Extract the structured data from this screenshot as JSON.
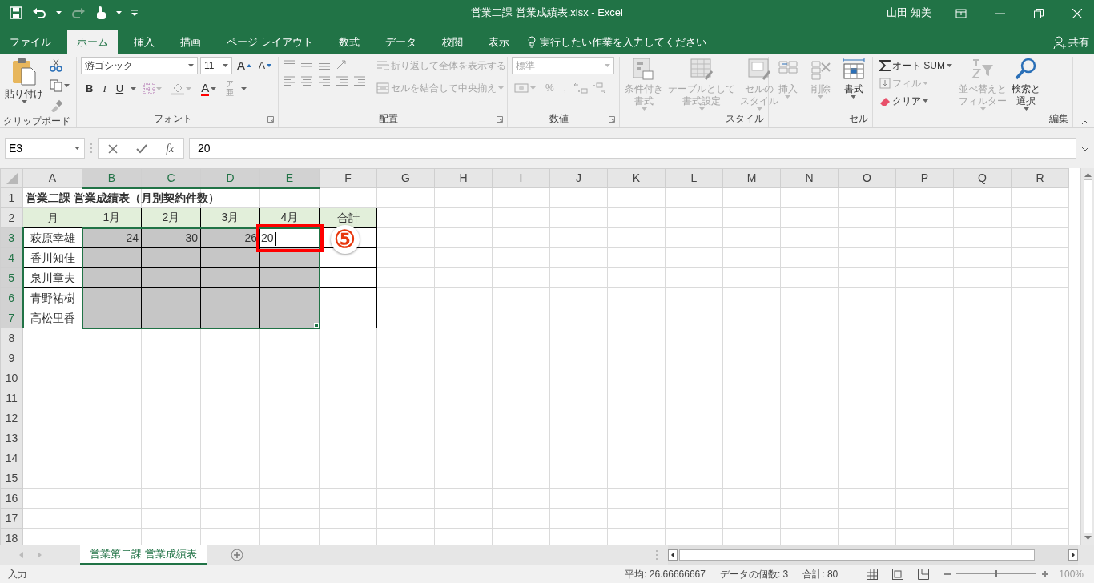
{
  "window": {
    "title": "営業二課 営業成績表.xlsx  -  Excel",
    "user": "山田 知美"
  },
  "ribbon_tabs": [
    {
      "label": "ファイル",
      "selected": false
    },
    {
      "label": "ホーム",
      "selected": true
    },
    {
      "label": "挿入",
      "selected": false
    },
    {
      "label": "描画",
      "selected": false
    },
    {
      "label": "ページ レイアウト",
      "selected": false
    },
    {
      "label": "数式",
      "selected": false
    },
    {
      "label": "データ",
      "selected": false
    },
    {
      "label": "校閲",
      "selected": false
    },
    {
      "label": "表示",
      "selected": false
    }
  ],
  "tell_me": {
    "placeholder": "実行したい作業を入力してください"
  },
  "share": "共有",
  "clipboard": {
    "paste": "貼り付け",
    "label": "クリップボード"
  },
  "font": {
    "name": "游ゴシック",
    "size": "11",
    "grow": "A",
    "shrink": "A",
    "styles": [
      "B",
      "I",
      "U"
    ],
    "color_button": "A",
    "phonetic": [
      "ア",
      "亜"
    ],
    "label": "フォント"
  },
  "alignment": {
    "wrap": "折り返して全体を表示する",
    "merge": "セルを結合して中央揃え",
    "label": "配置"
  },
  "number": {
    "format": "標準",
    "percent": "%",
    "comma": ",",
    "label": "数値"
  },
  "styles": {
    "buttons": [
      {
        "lines": [
          "条件付き",
          "書式"
        ],
        "disabled": true
      },
      {
        "lines": [
          "テーブルとして",
          "書式設定"
        ],
        "disabled": true
      },
      {
        "lines": [
          "セルの",
          "スタイル"
        ],
        "disabled": true
      }
    ],
    "label": "スタイル"
  },
  "cells": {
    "buttons": [
      {
        "lines": [
          "挿入"
        ],
        "disabled": true
      },
      {
        "lines": [
          "削除"
        ],
        "disabled": true
      },
      {
        "lines": [
          "書式"
        ],
        "disabled": false
      }
    ],
    "label": "セル"
  },
  "editing": {
    "autosum": "オート SUM",
    "fill": {
      "text": "フィル",
      "disabled": true
    },
    "clear": {
      "text": "クリア",
      "disabled": false
    },
    "sort": {
      "lines": [
        "並べ替えと",
        "フィルター"
      ],
      "disabled": true
    },
    "find": {
      "lines": [
        "検索と",
        "選択"
      ],
      "disabled": false
    },
    "label": "編集"
  },
  "formula_bar": {
    "name_box": "E3",
    "fx": "fx",
    "value": "20"
  },
  "columns": [
    {
      "label": "A",
      "selected": false
    },
    {
      "label": "B",
      "selected": true
    },
    {
      "label": "C",
      "selected": true
    },
    {
      "label": "D",
      "selected": true
    },
    {
      "label": "E",
      "selected": true
    },
    {
      "label": "F",
      "selected": false
    },
    {
      "label": "G",
      "selected": false
    },
    {
      "label": "H",
      "selected": false
    },
    {
      "label": "I",
      "selected": false
    },
    {
      "label": "J",
      "selected": false
    },
    {
      "label": "K",
      "selected": false
    },
    {
      "label": "L",
      "selected": false
    },
    {
      "label": "M",
      "selected": false
    },
    {
      "label": "N",
      "selected": false
    },
    {
      "label": "O",
      "selected": false
    },
    {
      "label": "P",
      "selected": false
    },
    {
      "label": "Q",
      "selected": false
    },
    {
      "label": "R",
      "selected": false
    }
  ],
  "rows": [
    {
      "label": "1",
      "selected": false,
      "cells": [
        {
          "kind": "title",
          "text": "営業二課 営業成績表（月別契約件数）",
          "selected": false
        }
      ]
    },
    {
      "label": "2",
      "selected": false,
      "cells": [
        {
          "kind": "header",
          "text": "月",
          "selected": false
        },
        {
          "kind": "header",
          "text": "1月",
          "selected": false
        },
        {
          "kind": "header",
          "text": "2月",
          "selected": false
        },
        {
          "kind": "header",
          "text": "3月",
          "selected": false
        },
        {
          "kind": "header",
          "text": "4月",
          "selected": false
        },
        {
          "kind": "header",
          "text": "合計",
          "selected": false
        }
      ]
    },
    {
      "label": "3",
      "selected": true,
      "cells": [
        {
          "kind": "name",
          "text": "萩原幸雄",
          "selected": false
        },
        {
          "kind": "number",
          "text": "24",
          "selected": true
        },
        {
          "kind": "number",
          "text": "30",
          "selected": true
        },
        {
          "kind": "number",
          "text": "26",
          "selected": true
        },
        {
          "kind": "editing",
          "text": "20",
          "selected": true
        },
        {
          "kind": "blank",
          "selected": false
        }
      ]
    },
    {
      "label": "4",
      "selected": true,
      "cells": [
        {
          "kind": "name",
          "text": "香川知佳",
          "selected": false
        },
        {
          "kind": "blank",
          "selected": true
        },
        {
          "kind": "blank",
          "selected": true
        },
        {
          "kind": "blank",
          "selected": true
        },
        {
          "kind": "blank",
          "selected": true
        },
        {
          "kind": "blank",
          "selected": false
        }
      ]
    },
    {
      "label": "5",
      "selected": true,
      "cells": [
        {
          "kind": "name",
          "text": "泉川章夫",
          "selected": false
        },
        {
          "kind": "blank",
          "selected": true
        },
        {
          "kind": "blank",
          "selected": true
        },
        {
          "kind": "blank",
          "selected": true
        },
        {
          "kind": "blank",
          "selected": true
        },
        {
          "kind": "blank",
          "selected": false
        }
      ]
    },
    {
      "label": "6",
      "selected": true,
      "cells": [
        {
          "kind": "name",
          "text": "青野祐樹",
          "selected": false
        },
        {
          "kind": "blank",
          "selected": true
        },
        {
          "kind": "blank",
          "selected": true
        },
        {
          "kind": "blank",
          "selected": true
        },
        {
          "kind": "blank",
          "selected": true
        },
        {
          "kind": "blank",
          "selected": false
        }
      ]
    },
    {
      "label": "7",
      "selected": true,
      "cells": [
        {
          "kind": "name",
          "text": "高松里香",
          "selected": false
        },
        {
          "kind": "blank",
          "selected": true
        },
        {
          "kind": "blank",
          "selected": true
        },
        {
          "kind": "blank",
          "selected": true
        },
        {
          "kind": "blank",
          "selected": true
        },
        {
          "kind": "blank",
          "selected": false
        }
      ]
    },
    {
      "label": "8",
      "selected": false
    },
    {
      "label": "9",
      "selected": false
    },
    {
      "label": "10",
      "selected": false
    },
    {
      "label": "11",
      "selected": false
    },
    {
      "label": "12",
      "selected": false
    },
    {
      "label": "13",
      "selected": false
    },
    {
      "label": "14",
      "selected": false
    },
    {
      "label": "15",
      "selected": false
    },
    {
      "label": "16",
      "selected": false
    },
    {
      "label": "17",
      "selected": false
    },
    {
      "label": "18",
      "selected": false
    }
  ],
  "annotation": {
    "label": "⑤"
  },
  "sheet_tabs": [
    {
      "label": "営業第二課 営業成績表",
      "selected": true
    }
  ],
  "status_bar": {
    "mode": "入力",
    "average": "平均: 26.66666667",
    "count": "データの個数: 3",
    "sum": "合計: 80",
    "zoom_slider": {
      "level": 0.5
    },
    "zoom": "100%"
  }
}
